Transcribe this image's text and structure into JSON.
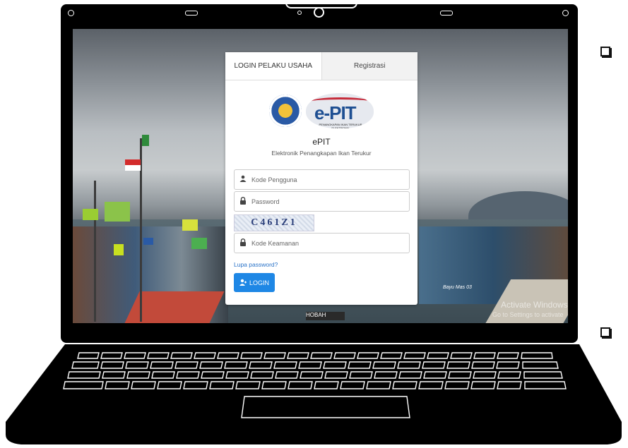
{
  "tabs": [
    {
      "label": "LOGIN PELAKU USAHA",
      "active": true
    },
    {
      "label": "Registrasi",
      "active": false
    }
  ],
  "logo": {
    "epit_text": "e-PIT",
    "tagline": "PENANGKAPAN IKAN TERUKUR ELEKTRONIK"
  },
  "app": {
    "name": "ePIT",
    "description": "Elektronik Penangkapan Ikan Terukur"
  },
  "form": {
    "username_placeholder": "Kode Pengguna",
    "password_placeholder": "Password",
    "captcha_text": "C461Z1",
    "security_placeholder": "Kode Keamanan",
    "forgot_link": "Lupa password?",
    "login_button": "LOGIN"
  },
  "icons": {
    "user": "user-icon",
    "lock": "lock-icon",
    "login": "login-user-icon"
  },
  "colors": {
    "accent": "#1e87e5",
    "link": "#2a73c8",
    "logo_blue": "#1e4f92",
    "logo_red": "#c62b3a"
  },
  "background": {
    "boat_label": "HOBAH",
    "boat_name": "Bayu Mas 03"
  },
  "watermark": {
    "title": "Activate Windows",
    "subtitle": "Go to Settings to activate"
  }
}
